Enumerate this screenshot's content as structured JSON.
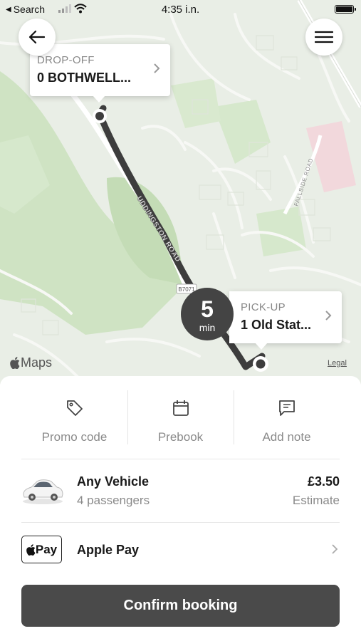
{
  "status_bar": {
    "back_app": "Search",
    "time": "4:35 i.n."
  },
  "map": {
    "road_label": "UDDINGSTON ROAD",
    "road_label_2": "FALLSIDE ROAD",
    "road_shield": "B7071",
    "maps_brand": "Maps",
    "legal": "Legal"
  },
  "dropoff": {
    "label": "DROP-OFF",
    "value": "0 BOTHWELL..."
  },
  "pickup": {
    "label": "PICK-UP",
    "value": "1 Old Stat..."
  },
  "eta": {
    "value": "5",
    "unit": "min"
  },
  "actions": [
    {
      "label": "Promo code",
      "icon": "tag-icon"
    },
    {
      "label": "Prebook",
      "icon": "calendar-icon"
    },
    {
      "label": "Add note",
      "icon": "note-icon"
    }
  ],
  "vehicle": {
    "name": "Any Vehicle",
    "passengers": "4 passengers",
    "price": "£3.50",
    "price_note": "Estimate"
  },
  "payment": {
    "badge": "Pay",
    "method": "Apple Pay"
  },
  "confirm_button": "Confirm booking",
  "colors": {
    "map_bg": "#e9eee6",
    "park_green": "#cfe3c3",
    "route": "#3d3d3d",
    "button": "#4a4a4a",
    "muted_text": "#8a8a8a"
  }
}
